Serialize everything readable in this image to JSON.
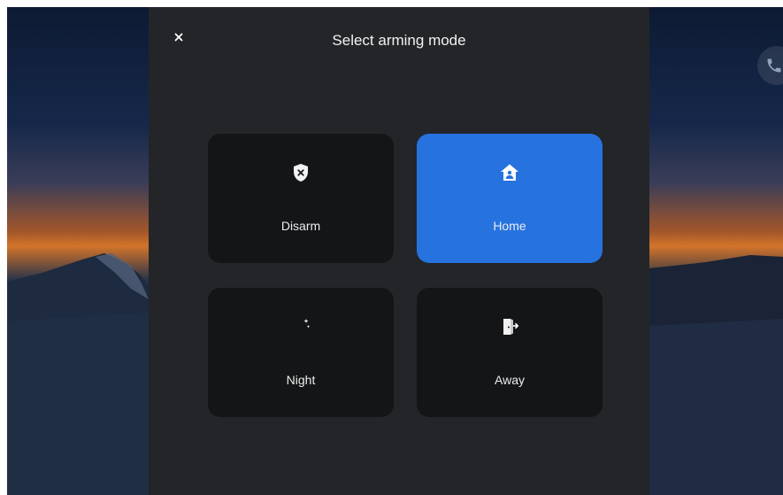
{
  "dialog": {
    "title": "Select arming mode",
    "close_icon": "close-icon"
  },
  "modes": [
    {
      "label": "Disarm",
      "icon": "shield-x-icon",
      "selected": false
    },
    {
      "label": "Home",
      "icon": "home-person-icon",
      "selected": true
    },
    {
      "label": "Night",
      "icon": "moon-stars-icon",
      "selected": false
    },
    {
      "label": "Away",
      "icon": "door-exit-icon",
      "selected": false
    }
  ],
  "side_button": {
    "icon": "phone-icon"
  },
  "colors": {
    "dialog_background": "#232528",
    "tile_background": "#141517",
    "selected_accent": "#2673e0",
    "text": "#ececec"
  }
}
